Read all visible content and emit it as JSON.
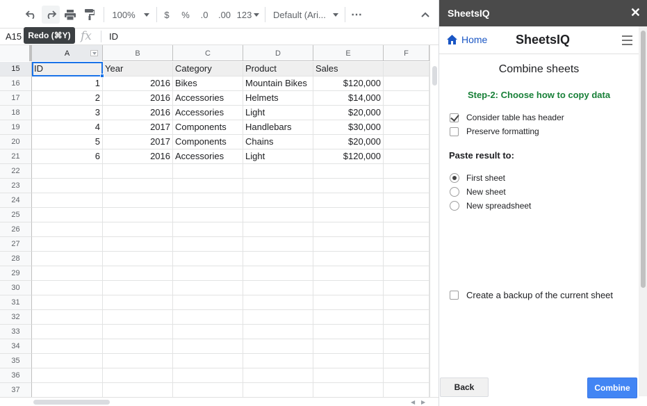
{
  "toolbar": {
    "zoom": "100%",
    "currency": "$",
    "percent": "%",
    "decrease_decimals": ".0",
    "increase_decimals": ".00",
    "more_formats": "123",
    "font": "Default (Ari...",
    "more": "⋯"
  },
  "tooltip": {
    "text": "Redo (⌘Y)"
  },
  "formula_bar": {
    "name_box": "A15",
    "fx": "fx",
    "value": "ID"
  },
  "grid": {
    "columns": [
      "A",
      "B",
      "C",
      "D",
      "E",
      "F"
    ],
    "row_numbers": [
      "15",
      "16",
      "17",
      "18",
      "19",
      "20",
      "21",
      "22",
      "23",
      "24",
      "25",
      "26",
      "27",
      "28",
      "29",
      "30",
      "31",
      "32",
      "33",
      "34",
      "35",
      "36",
      "37"
    ],
    "rows": [
      [
        "ID",
        "Year",
        "Category",
        "Product",
        "Sales"
      ],
      [
        "1",
        "2016",
        "Bikes",
        "Mountain Bikes",
        "$120,000"
      ],
      [
        "2",
        "2016",
        "Accessories",
        "Helmets",
        "$14,000"
      ],
      [
        "3",
        "2016",
        "Accessories",
        "Light",
        "$20,000"
      ],
      [
        "4",
        "2017",
        "Components",
        "Handlebars",
        "$30,000"
      ],
      [
        "5",
        "2017",
        "Components",
        "Chains",
        "$20,000"
      ],
      [
        "6",
        "2016",
        "Accessories",
        "Light",
        "$120,000"
      ]
    ]
  },
  "sidebar": {
    "title": "SheetsIQ",
    "close": "✕",
    "home": "Home",
    "brand": "SheetsIQ",
    "panel_title": "Combine sheets",
    "step": "Step-2: Choose how to copy data",
    "options": {
      "header": {
        "label": "Consider table has header",
        "checked": true
      },
      "formatting": {
        "label": "Preserve formatting",
        "checked": false
      }
    },
    "paste_label": "Paste result to:",
    "paste": {
      "first": {
        "label": "First sheet",
        "checked": true
      },
      "new_sheet": {
        "label": "New sheet",
        "checked": false
      },
      "new_spreadsheet": {
        "label": "New spreadsheet",
        "checked": false
      }
    },
    "backup": {
      "label": "Create a backup of the current sheet",
      "checked": false
    },
    "back_button": "Back",
    "combine_button": "Combine"
  },
  "colors": {
    "accent": "#1a73e8",
    "step": "#188038",
    "combine": "#4285f4",
    "sidebar_title_bg": "#4a4a4a"
  }
}
